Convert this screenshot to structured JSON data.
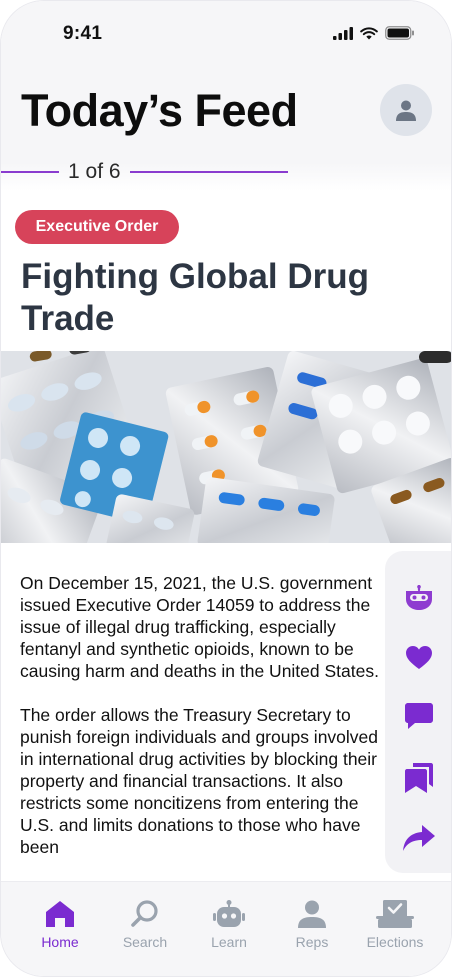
{
  "status_bar": {
    "time": "9:41"
  },
  "header": {
    "title": "Today’s Feed"
  },
  "pager": {
    "text": "1 of 6"
  },
  "article": {
    "category": "Executive Order",
    "title": "Fighting Global Drug Trade",
    "paragraphs": [
      "On December 15, 2021, the U.S. government issued Executive Order 14059 to address the issue of illegal drug trafficking, especially fentanyl and synthetic opioids, known to be causing harm and deaths in the United States.",
      "The order allows the Treasury Secretary to punish foreign individuals and groups involved in international drug activities by blocking their property and financial transactions. It also restricts some noncitizens from entering the U.S. and limits donations to those who have been"
    ]
  },
  "actions": [
    "bot-icon",
    "heart-icon",
    "comment-icon",
    "bookmark-icon",
    "share-icon"
  ],
  "tabs": [
    {
      "label": "Home",
      "icon": "home-icon",
      "active": true
    },
    {
      "label": "Search",
      "icon": "search-icon",
      "active": false
    },
    {
      "label": "Learn",
      "icon": "robot-icon",
      "active": false
    },
    {
      "label": "Reps",
      "icon": "person-icon",
      "active": false
    },
    {
      "label": "Elections",
      "icon": "ballot-icon",
      "active": false
    }
  ],
  "colors": {
    "accent": "#7b2bd0",
    "badge": "#d7435a",
    "icon_inactive": "#9aa3ae",
    "title": "#2d3643"
  }
}
